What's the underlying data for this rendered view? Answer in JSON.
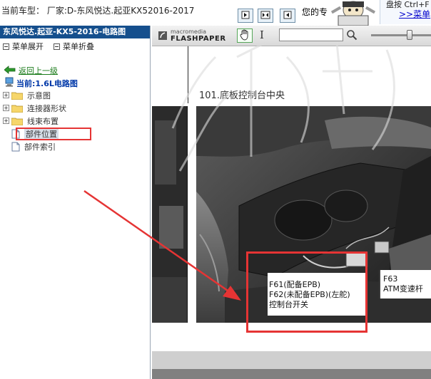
{
  "topbar": {
    "vehicle_title": "当前车型： 厂家:D-东风悦达.起亚KX52016-2017",
    "partial_text": "您的专",
    "hint_line": "盘按 Ctrl+F",
    "menu_link": ">>菜单"
  },
  "left_panel": {
    "header": "东风悦达.起亚-KX5-2016-电路图",
    "expand_label": "菜单展开",
    "collapse_label": "菜单折叠",
    "back_link": "返回上一级",
    "current_label": "当前:1.6L电路图",
    "tree": [
      {
        "label": "示意图",
        "type": "folder"
      },
      {
        "label": "连接器形状",
        "type": "folder"
      },
      {
        "label": "线束布置",
        "type": "folder"
      },
      {
        "label": "部件位置",
        "type": "doc",
        "selected": true
      },
      {
        "label": "部件索引",
        "type": "doc"
      }
    ]
  },
  "flash_toolbar": {
    "brand_top": "macromedia",
    "brand_bottom": "FLASHPAPER",
    "zoom_level": 0.64
  },
  "document": {
    "page_title": "101.底板控制台中央",
    "callout_lines": [
      "F61(配备EPB)",
      "F62(未配备EPB)(左舵)",
      "控制台开关"
    ],
    "right_callout": [
      "F63",
      "ATM变速杆"
    ]
  },
  "colors": {
    "header_blue": "#154f8d",
    "highlight_red": "#e53434",
    "link_green": "#1a7b1a"
  }
}
